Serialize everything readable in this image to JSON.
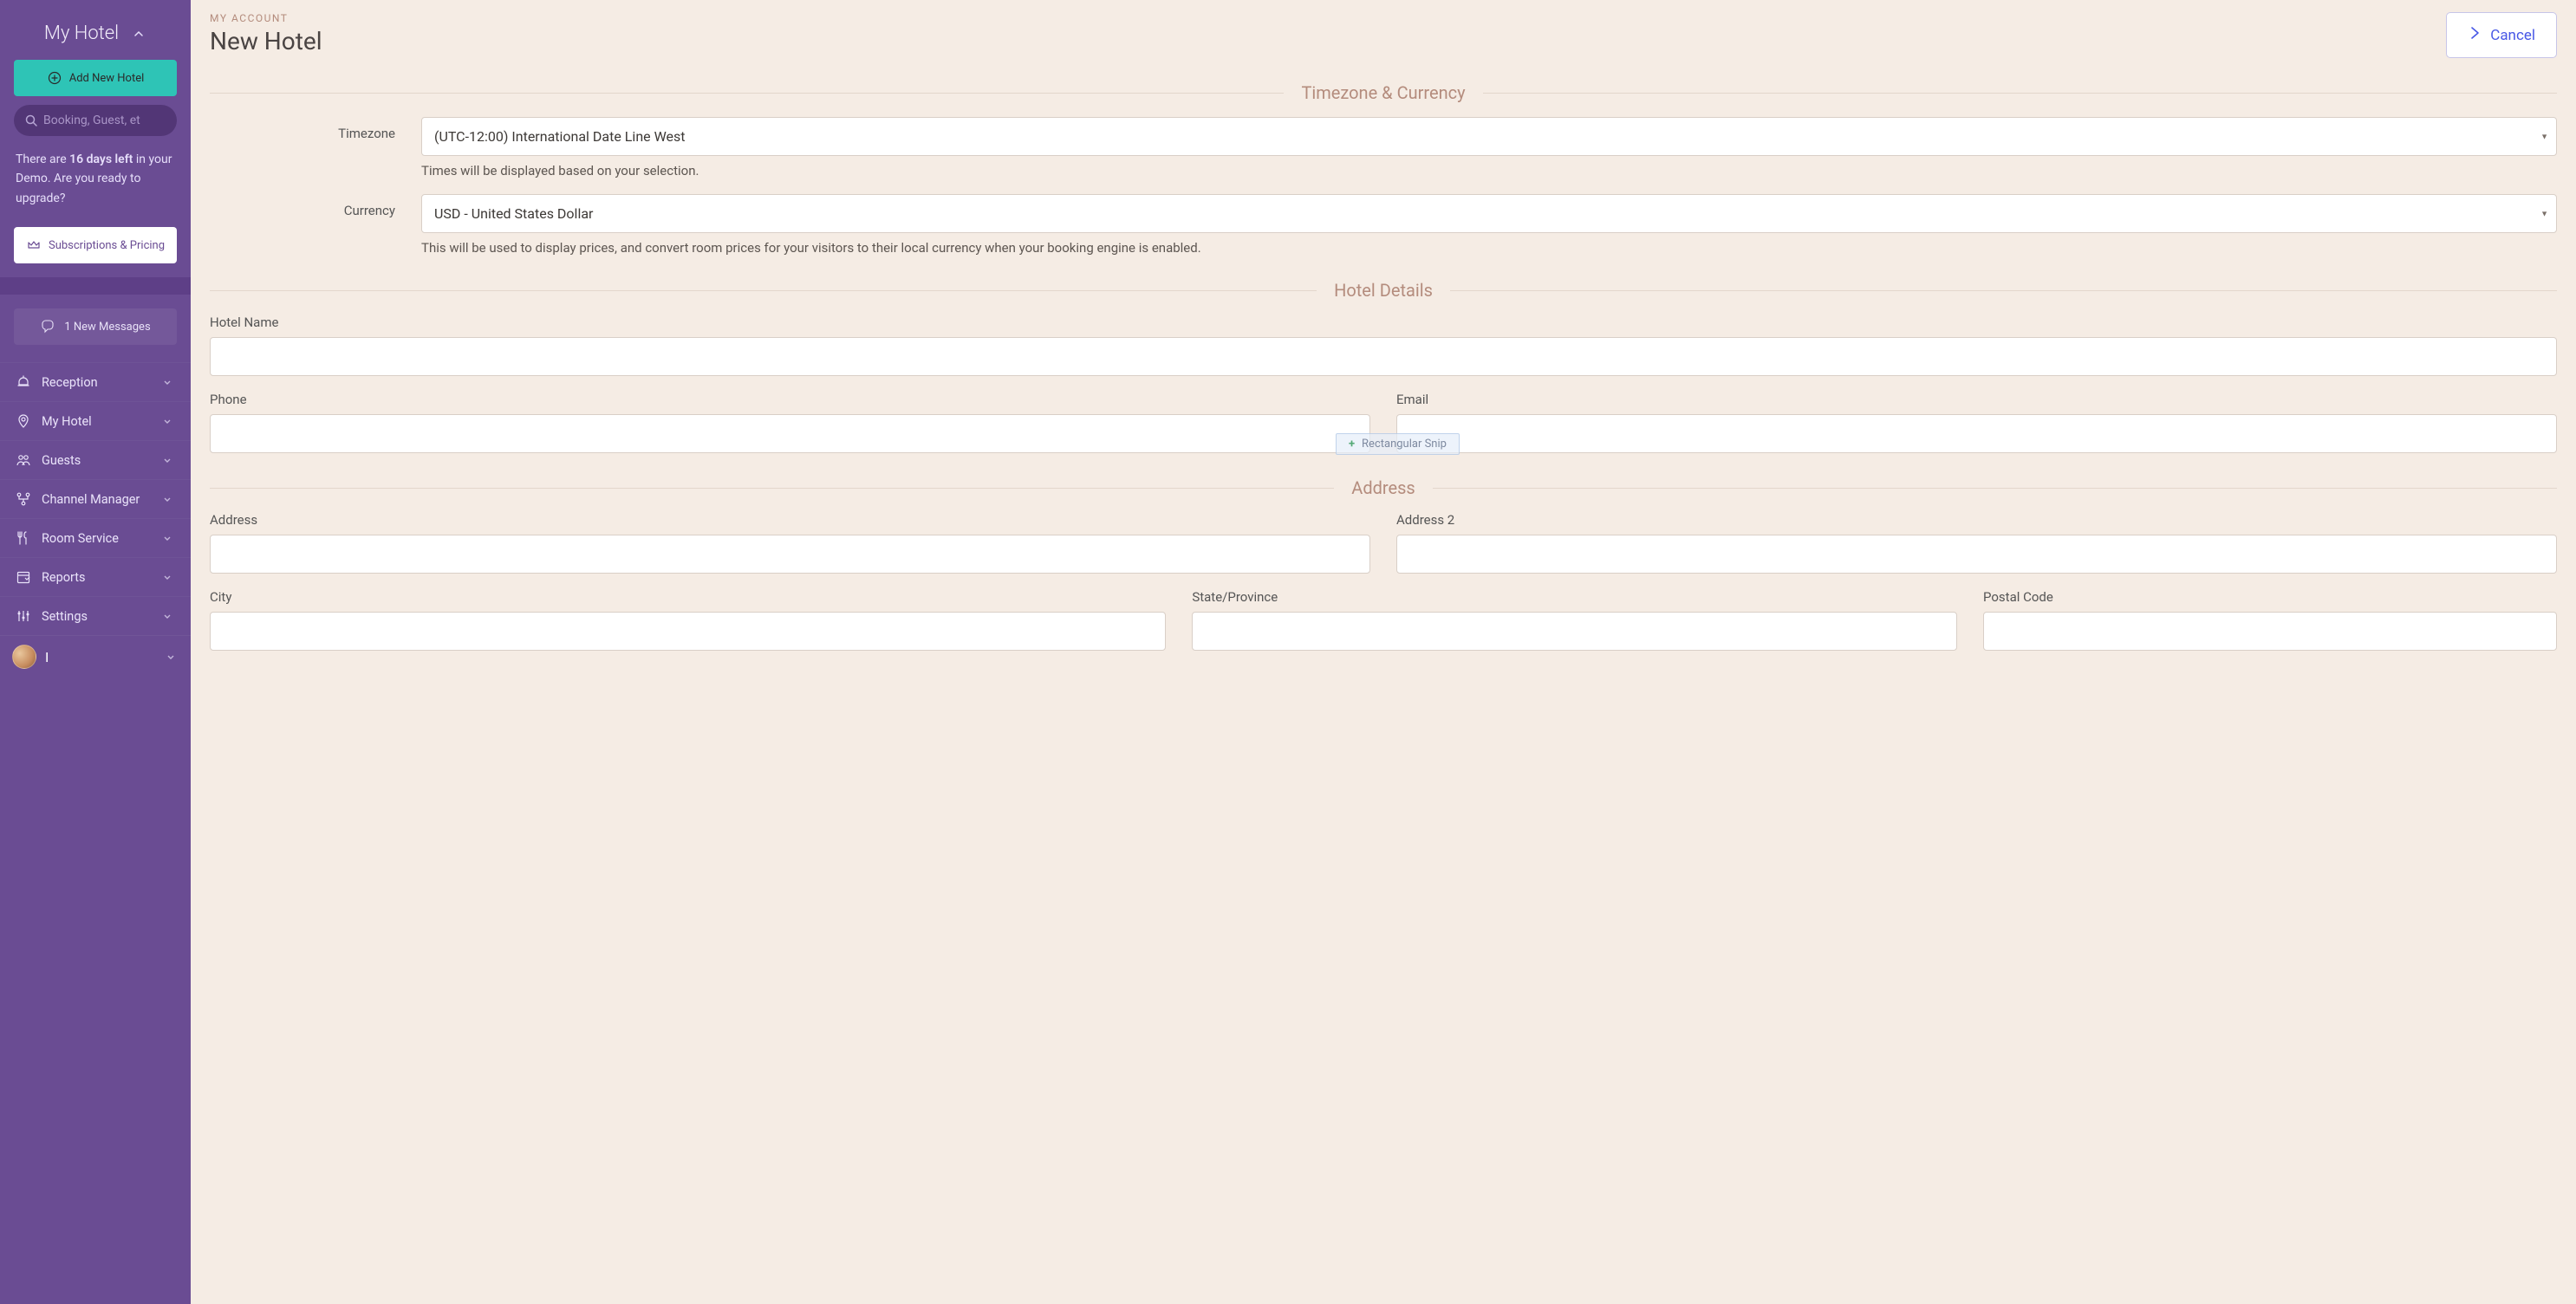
{
  "sidebar": {
    "hotel_switch_label": "My Hotel",
    "add_hotel_label": "Add New Hotel",
    "search_placeholder": "Booking, Guest, et",
    "demo_before": "There are ",
    "demo_bold": "16 days left",
    "demo_after": " in your Demo. Are you ready to upgrade?",
    "sub_pricing_label": "Subscriptions & Pricing",
    "messages_label": "1 New Messages",
    "nav": [
      {
        "label": "Reception"
      },
      {
        "label": "My Hotel"
      },
      {
        "label": "Guests"
      },
      {
        "label": "Channel Manager"
      },
      {
        "label": "Room Service"
      },
      {
        "label": "Reports"
      },
      {
        "label": "Settings"
      }
    ],
    "user_initial": "I"
  },
  "header": {
    "breadcrumb": "MY ACCOUNT",
    "title": "New Hotel",
    "cancel_label": "Cancel"
  },
  "sections": {
    "tz_currency": {
      "heading": "Timezone & Currency",
      "timezone_label": "Timezone",
      "timezone_value": "(UTC-12:00) International Date Line West",
      "timezone_help": "Times will be displayed based on your selection.",
      "currency_label": "Currency",
      "currency_value": "USD - United States Dollar",
      "currency_help": "This will be used to display prices, and convert room prices for your visitors to their local currency when your booking engine is enabled."
    },
    "hotel_details": {
      "heading": "Hotel Details",
      "hotel_name_label": "Hotel Name",
      "phone_label": "Phone",
      "email_label": "Email"
    },
    "address": {
      "heading": "Address",
      "address_label": "Address",
      "address2_label": "Address 2",
      "city_label": "City",
      "state_label": "State/Province",
      "postal_label": "Postal Code"
    }
  },
  "overlay": {
    "snip_label": "Rectangular Snip"
  }
}
